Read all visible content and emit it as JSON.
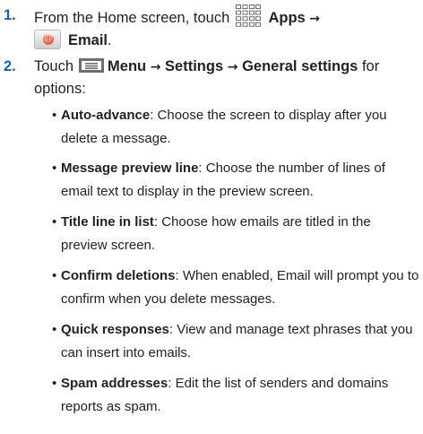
{
  "step1": {
    "number": "1.",
    "prefix": "From the Home screen, touch",
    "apps_icon": "apps-grid-icon",
    "apps_label": "Apps",
    "arrow": "→",
    "email_icon": "email-app-icon",
    "email_label": "Email",
    "suffix": "."
  },
  "step2": {
    "number": "2.",
    "prefix": "Touch",
    "menu_icon": "menu-icon",
    "menu_label": "Menu",
    "arrow1": "→",
    "settings_label": "Settings",
    "arrow2": "→",
    "general_label": "General settings",
    "suffix": "for options:"
  },
  "bullets": [
    {
      "term": "Auto-advance",
      "desc": ": Choose the screen to display after you delete a message."
    },
    {
      "term": "Message preview line",
      "desc": ": Choose the number of lines of email text to display in the preview screen."
    },
    {
      "term": "Title line in list",
      "desc": ": Choose how emails are titled in the preview screen."
    },
    {
      "term": "Confirm deletions",
      "desc": ": When enabled, Email will prompt you to confirm when you delete messages."
    },
    {
      "term": "Quick responses",
      "desc": ": View and manage text phrases that you can insert into emails."
    },
    {
      "term": "Spam addresses",
      "desc": ": Edit the list of senders and domains reports as spam."
    }
  ],
  "colors": {
    "step_number": "#1f5fa8",
    "text": "#222222",
    "email_badge": "#e8402a"
  }
}
